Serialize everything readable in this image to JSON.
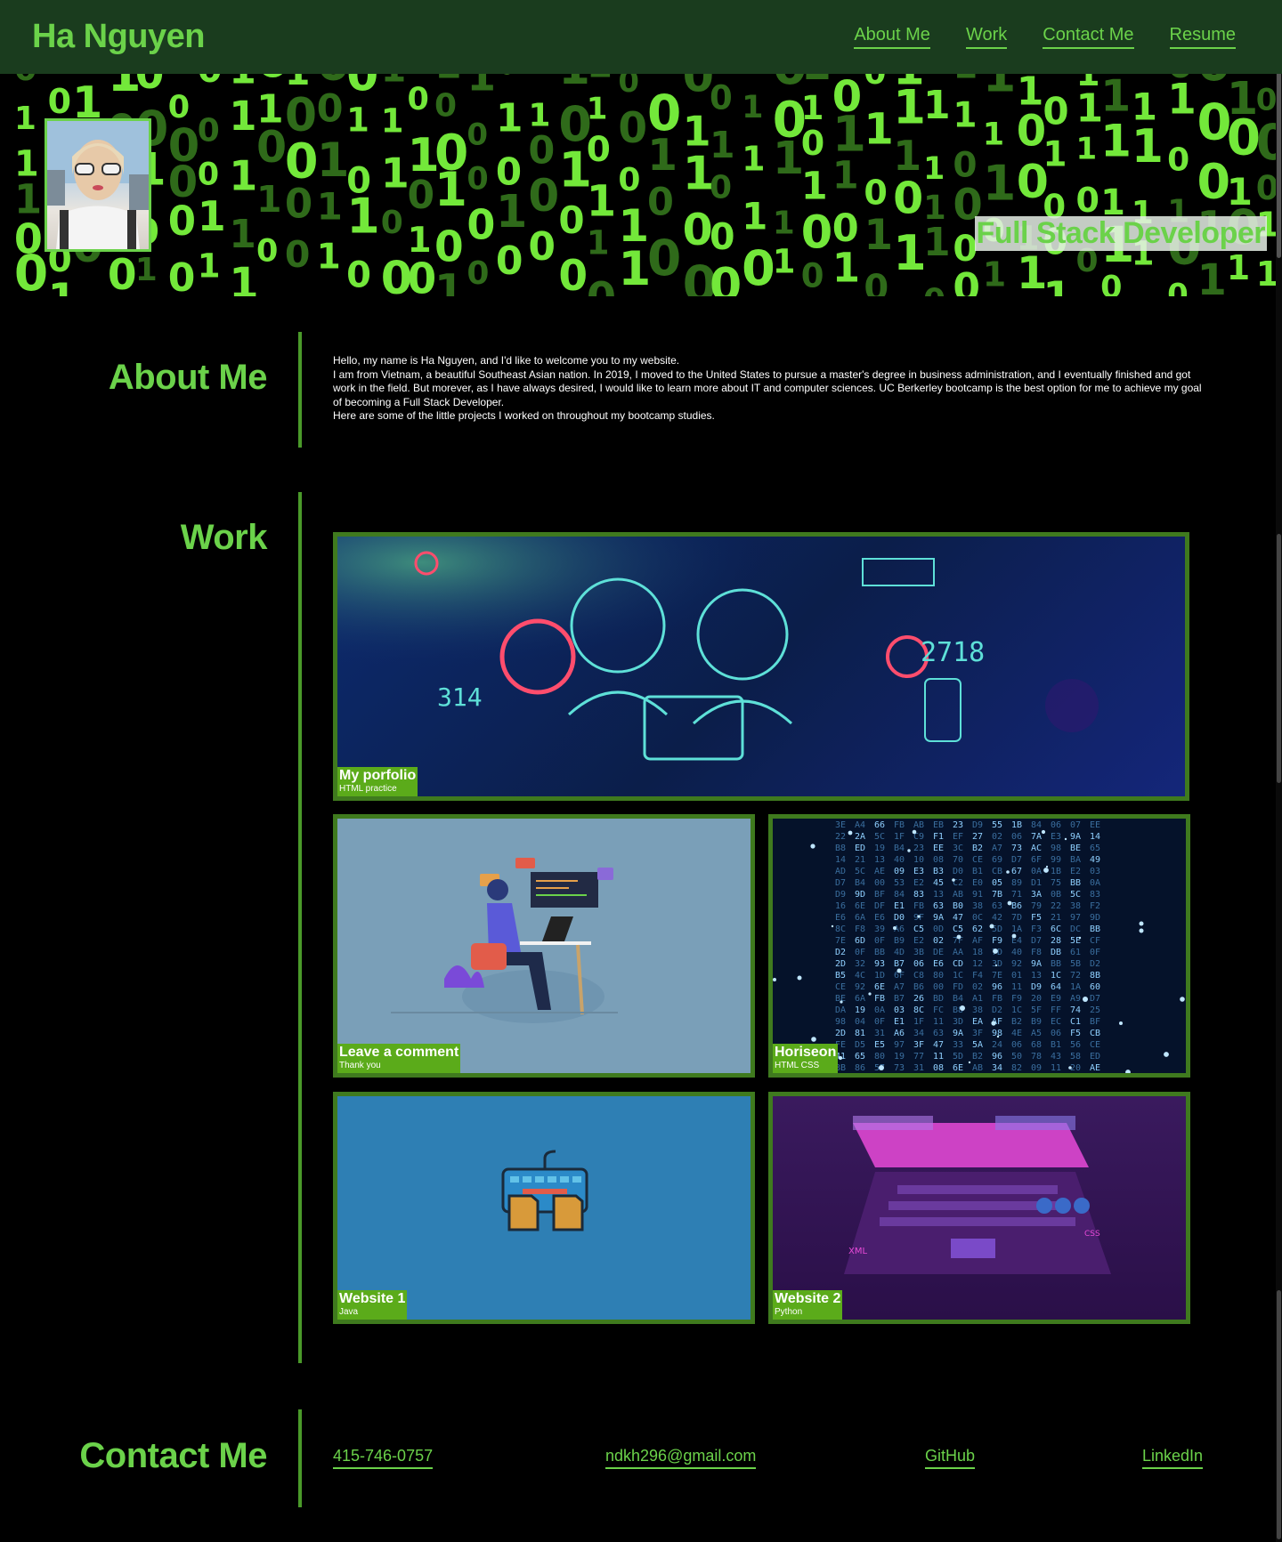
{
  "header": {
    "brand": "Ha Nguyen",
    "nav": [
      {
        "label": "About Me"
      },
      {
        "label": "Work"
      },
      {
        "label": "Contact Me"
      },
      {
        "label": "Resume"
      }
    ]
  },
  "hero": {
    "tagline": "Full Stack Developer"
  },
  "about": {
    "title": "About Me",
    "paragraphs": [
      "Hello, my name is Ha Nguyen, and I'd like to welcome you to my website.",
      "I am from Vietnam, a beautiful Southeast Asian nation. In 2019, I moved to the United States to pursue a master's degree in business administration, and I eventually finished and got work in the field. But morever, as I have always desired, I would like to learn more about IT and computer sciences. UC Berkerley bootcamp is the best option for me to achieve my goal of becoming a Full Stack Developer.",
      "Here are some of the little projects I worked on throughout my bootcamp studies."
    ]
  },
  "work": {
    "title": "Work",
    "projects": [
      {
        "title": "My porfolio",
        "subtitle": "HTML practice"
      },
      {
        "title": "Leave a comment",
        "subtitle": "Thank you"
      },
      {
        "title": "Horiseon",
        "subtitle": "HTML CSS"
      },
      {
        "title": "Website 1",
        "subtitle": "Java"
      },
      {
        "title": "Website 2",
        "subtitle": "Python"
      }
    ]
  },
  "contact": {
    "title": "Contact Me",
    "phone": "415-746-0757",
    "email": "ndkh296@gmail.com",
    "github": "GitHub",
    "linkedin": "LinkedIn"
  },
  "colors": {
    "accent": "#6bd24a",
    "header_bg": "#1a3c1e",
    "card_border": "#3f7a1e",
    "label_bg": "#5bab1a"
  }
}
